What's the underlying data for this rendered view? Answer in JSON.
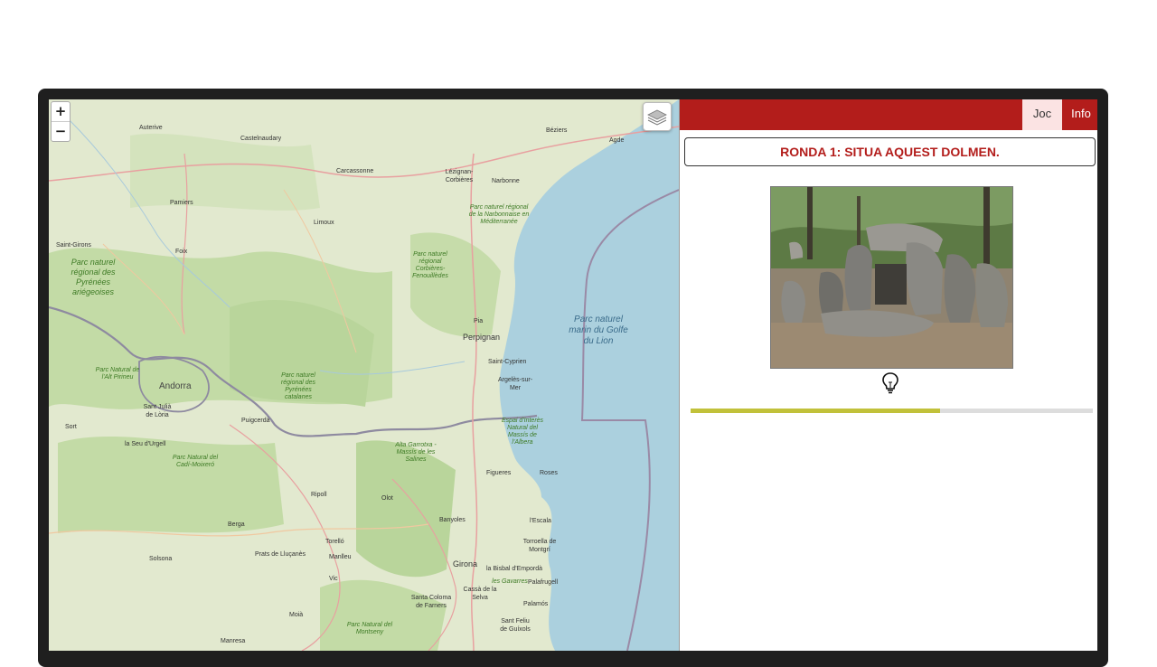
{
  "map": {
    "zoom_in": "+",
    "zoom_out": "−",
    "layers_icon": "layers-icon",
    "places": {
      "auterive": "Auterive",
      "castelnaudary": "Castelnaudary",
      "beziers": "Béziers",
      "agde": "Agde",
      "carcassonne": "Carcassonne",
      "lezignan": "Lézignan-Corbières",
      "narbonne": "Narbonne",
      "pamiers": "Pamiers",
      "limoux": "Limoux",
      "saint_girons": "Saint-Girons",
      "foix": "Foix",
      "perpignan": "Perpignan",
      "pia": "Pia",
      "saint_cyprien": "Saint-Cyprien",
      "argeles": "Argelès-sur-Mer",
      "andorra": "Andorra",
      "sant_julia": "Sant Julià de Lòria",
      "puigcerda": "Puigcerdà",
      "sort": "Sort",
      "seu_urgell": "la Seu d'Urgell",
      "figueres": "Figueres",
      "roses": "Roses",
      "ripoll": "Ripoll",
      "olot": "Olot",
      "banyoles": "Banyoles",
      "escala": "l'Escala",
      "torroella": "Torroella de Montgrí",
      "berga": "Berga",
      "prats": "Prats de Lluçanès",
      "solsona": "Solsona",
      "torello": "Torelló",
      "manlleu": "Manlleu",
      "vic": "Vic",
      "girona": "Girona",
      "bisbal": "la Bisbal d'Empordà",
      "cassa": "Cassà de la Selva",
      "palafrugell": "Palafrugell",
      "palamos": "Palamós",
      "santa_coloma": "Santa Coloma de Farners",
      "moia": "Moià",
      "manresa": "Manresa",
      "sant_feliu": "Sant Feliu de Guíxols",
      "gavarres": "les Gavarres"
    },
    "parks": {
      "narbonnaise": "Parc naturel régional de la Narbonnaise en Méditerranée",
      "corbieres": "Parc naturel régional Corbières-Fenouillèdes",
      "ariegeoises": "Parc naturel régional des Pyrénées ariégeoises",
      "marin": "Parc naturel marin du Golfe du Lion",
      "alt_pirineu": "Parc Natural de l'Alt Pirineu",
      "catalanes": "Parc naturel régional des Pyrénées catalanes",
      "cadi": "Parc Natural del Cadí-Moixeró",
      "albera": "Espai d'Interès Natural del Massís de l'Albera",
      "salines": "Alta Garrotxa - Massís de les Salines",
      "montseny": "Parc Natural del Montseny"
    }
  },
  "panel": {
    "tabs": {
      "joc": "Joc",
      "info": "Info"
    },
    "round_title": "RONDA 1: SITUA AQUEST DOLMEN.",
    "hint_icon": "lightbulb-icon",
    "progress": 0.62,
    "colors": {
      "brand": "#b31d1b",
      "progress": "#c1c13a",
      "tab_active_bg": "#fbe3e3"
    }
  }
}
